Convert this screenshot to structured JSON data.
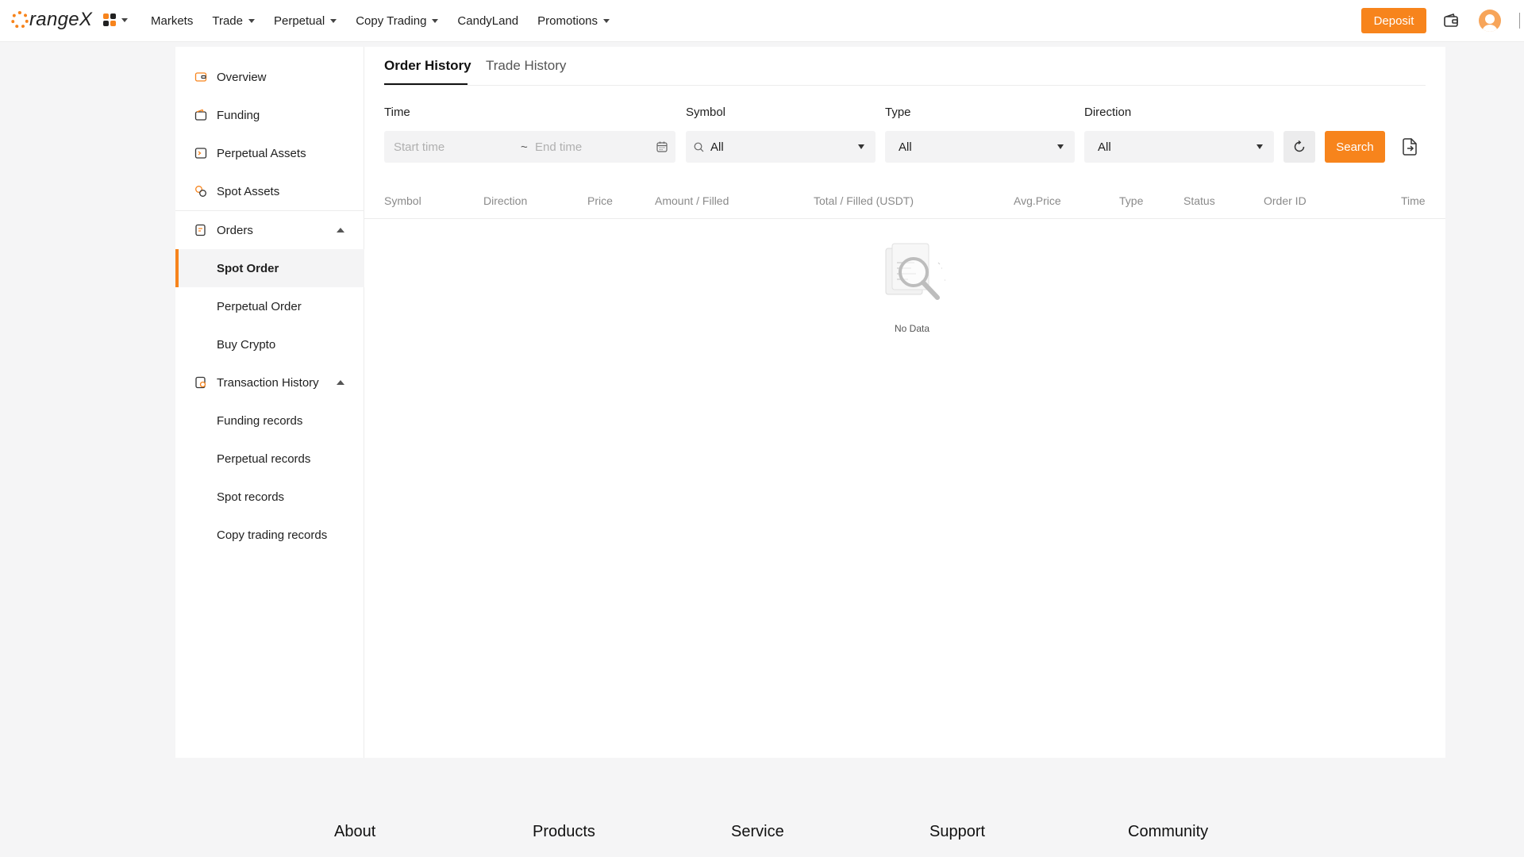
{
  "header": {
    "logo_text": "rangeX",
    "nav": [
      {
        "label": "Markets",
        "dropdown": false
      },
      {
        "label": "Trade",
        "dropdown": true
      },
      {
        "label": "Perpetual",
        "dropdown": true
      },
      {
        "label": "Copy Trading",
        "dropdown": true
      },
      {
        "label": "CandyLand",
        "dropdown": false
      },
      {
        "label": "Promotions",
        "dropdown": true
      }
    ],
    "deposit_label": "Deposit",
    "accent_color": "#f7841c"
  },
  "sidebar": {
    "items": [
      {
        "label": "Overview",
        "icon": "wallet-icon"
      },
      {
        "label": "Funding",
        "icon": "funding-wallet-icon"
      },
      {
        "label": "Perpetual Assets",
        "icon": "perpetual-assets-icon"
      },
      {
        "label": "Spot Assets",
        "icon": "spot-assets-icon"
      }
    ],
    "orders": {
      "label": "Orders",
      "icon": "orders-icon",
      "expanded": true,
      "children": [
        {
          "label": "Spot Order",
          "active": true
        },
        {
          "label": "Perpetual Order",
          "active": false
        },
        {
          "label": "Buy Crypto",
          "active": false
        }
      ]
    },
    "transaction_history": {
      "label": "Transaction History",
      "icon": "history-icon",
      "expanded": true,
      "children": [
        {
          "label": "Funding records"
        },
        {
          "label": "Perpetual records"
        },
        {
          "label": "Spot records"
        },
        {
          "label": "Copy trading records"
        }
      ]
    }
  },
  "main": {
    "tabs": [
      {
        "label": "Order History",
        "active": true
      },
      {
        "label": "Trade History",
        "active": false
      }
    ],
    "filters": {
      "time_label": "Time",
      "start_placeholder": "Start time",
      "range_separator": "~",
      "end_placeholder": "End time",
      "symbol_label": "Symbol",
      "symbol_value": "All",
      "type_label": "Type",
      "type_value": "All",
      "direction_label": "Direction",
      "direction_value": "All",
      "search_label": "Search"
    },
    "columns": [
      "Symbol",
      "Direction",
      "Price",
      "Amount / Filled",
      "Total / Filled (USDT)",
      "Avg.Price",
      "Type",
      "Status",
      "Order ID",
      "Time"
    ],
    "rows": [],
    "empty_text": "No Data"
  },
  "footer": {
    "columns": [
      "About",
      "Products",
      "Service",
      "Support",
      "Community"
    ]
  }
}
